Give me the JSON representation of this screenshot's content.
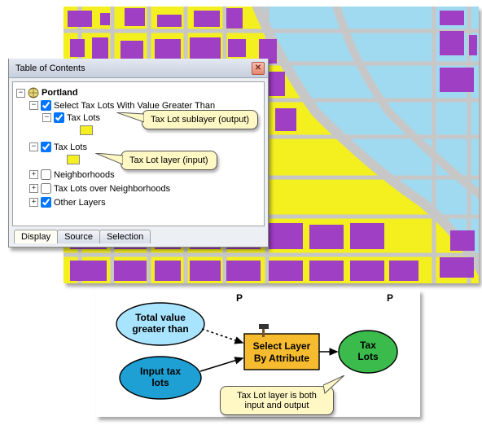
{
  "toc": {
    "title": "Table of Contents",
    "root": "Portland",
    "items": [
      {
        "label": "Select Tax Lots With Value Greater Than",
        "checked": true
      },
      {
        "label": "Tax Lots",
        "checked": true
      },
      {
        "label": "Tax Lots",
        "checked": true
      },
      {
        "label": "Neighborhoods",
        "checked": false
      },
      {
        "label": "Tax Lots over Neighborhoods",
        "checked": false
      },
      {
        "label": "Other Layers",
        "checked": true
      }
    ],
    "tabs": {
      "display": "Display",
      "source": "Source",
      "selection": "Selection"
    }
  },
  "callouts": {
    "sublayer": "Tax Lot sublayer (output)",
    "layer": "Tax Lot layer (input)",
    "both1": "Tax Lot layer is both",
    "both2": "input and output"
  },
  "model": {
    "p_label": "P",
    "oval_tv1": "Total value",
    "oval_tv2": "greater than",
    "oval_input1": "Input tax",
    "oval_input2": "lots",
    "proc1": "Select Layer",
    "proc2": "By Attribute",
    "oval_out1": "Tax",
    "oval_out2": "Lots"
  }
}
